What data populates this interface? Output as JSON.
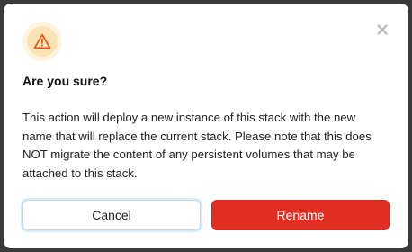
{
  "dialog": {
    "title": "Are you sure?",
    "message": "This action will deploy a new instance of this stack with the new name that will replace the current stack. Please note that this does NOT migrate the content of any persistent volumes that may be attached to this stack.",
    "close_icon": "close-icon",
    "warning_icon": "warning-triangle-icon"
  },
  "buttons": {
    "cancel_label": "Cancel",
    "confirm_label": "Rename"
  },
  "colors": {
    "confirm_bg": "#e02f22",
    "warning_accent": "#e8531f",
    "warning_halo": "#fde3b3"
  }
}
